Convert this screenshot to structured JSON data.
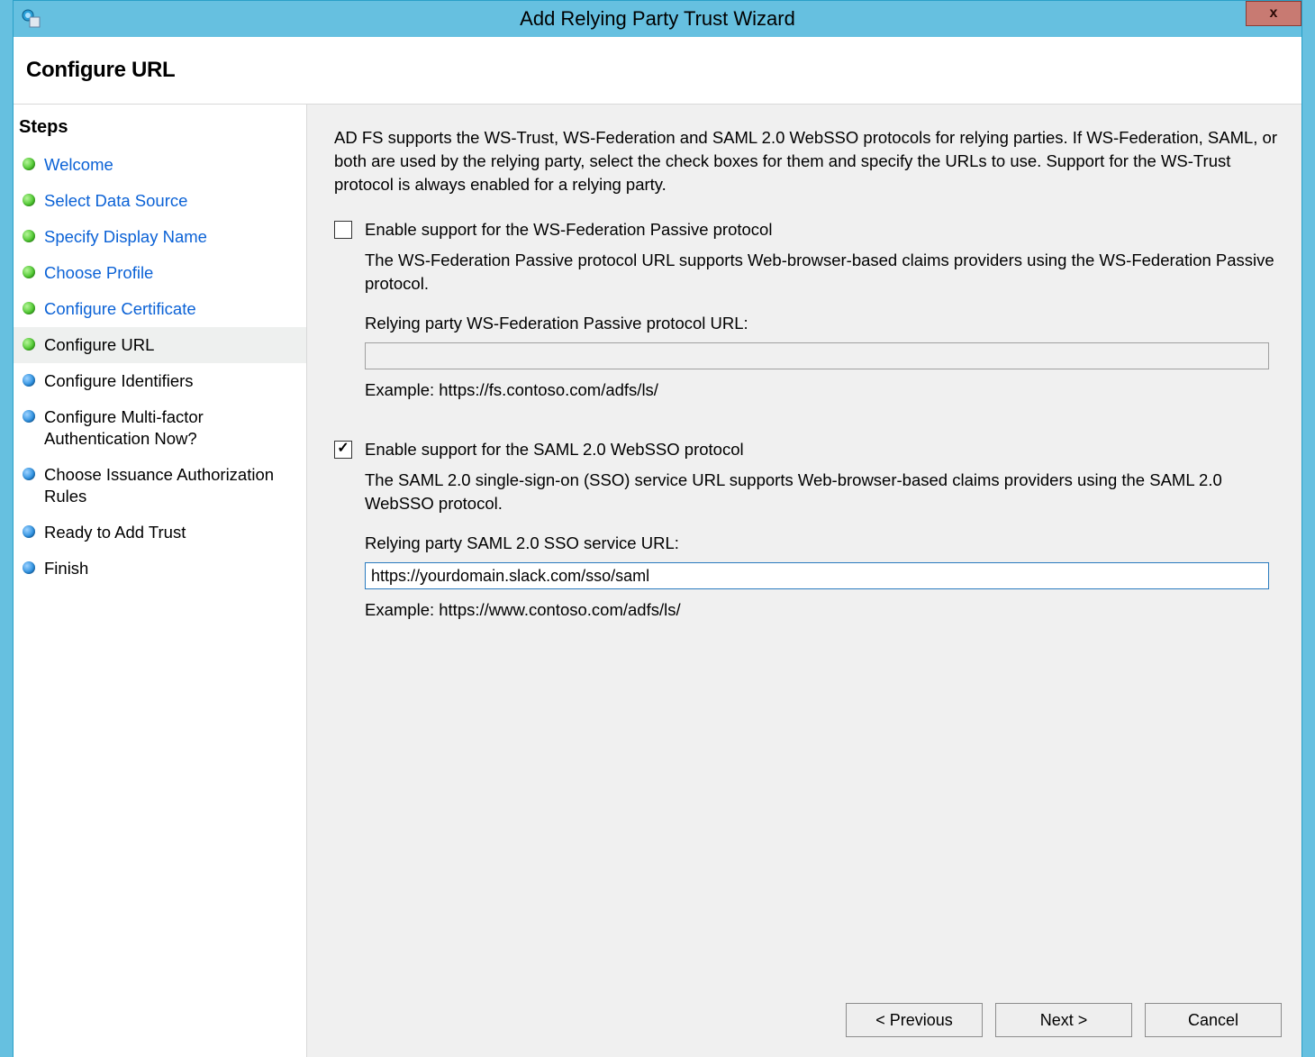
{
  "window": {
    "title": "Add Relying Party Trust Wizard",
    "page_heading": "Configure URL"
  },
  "sidebar": {
    "title": "Steps",
    "items": [
      {
        "label": "Welcome",
        "state": "done"
      },
      {
        "label": "Select Data Source",
        "state": "done"
      },
      {
        "label": "Specify Display Name",
        "state": "done"
      },
      {
        "label": "Choose Profile",
        "state": "done"
      },
      {
        "label": "Configure Certificate",
        "state": "done"
      },
      {
        "label": "Configure URL",
        "state": "current"
      },
      {
        "label": "Configure Identifiers",
        "state": "after"
      },
      {
        "label": "Configure Multi-factor Authentication Now?",
        "state": "after"
      },
      {
        "label": "Choose Issuance Authorization Rules",
        "state": "after"
      },
      {
        "label": "Ready to Add Trust",
        "state": "after"
      },
      {
        "label": "Finish",
        "state": "after"
      }
    ]
  },
  "main": {
    "intro": "AD FS supports the WS-Trust, WS-Federation and SAML 2.0 WebSSO protocols for relying parties.  If WS-Federation, SAML, or both are used by the relying party, select the check boxes for them and specify the URLs to use.  Support for the WS-Trust protocol is always enabled for a relying party.",
    "wsfed": {
      "checkbox_label": "Enable support for the WS-Federation Passive protocol",
      "checked": false,
      "description": "The WS-Federation Passive protocol URL supports Web-browser-based claims providers using the WS-Federation Passive protocol.",
      "url_label": "Relying party WS-Federation Passive protocol URL:",
      "url_value": "",
      "example": "Example: https://fs.contoso.com/adfs/ls/"
    },
    "saml": {
      "checkbox_label": "Enable support for the SAML 2.0 WebSSO protocol",
      "checked": true,
      "description": "The SAML 2.0 single-sign-on (SSO) service URL supports Web-browser-based claims providers using the SAML 2.0 WebSSO protocol.",
      "url_label": "Relying party SAML 2.0 SSO service URL:",
      "url_value": "https://yourdomain.slack.com/sso/saml",
      "example": "Example: https://www.contoso.com/adfs/ls/"
    }
  },
  "buttons": {
    "previous": "< Previous",
    "next": "Next >",
    "cancel": "Cancel"
  }
}
